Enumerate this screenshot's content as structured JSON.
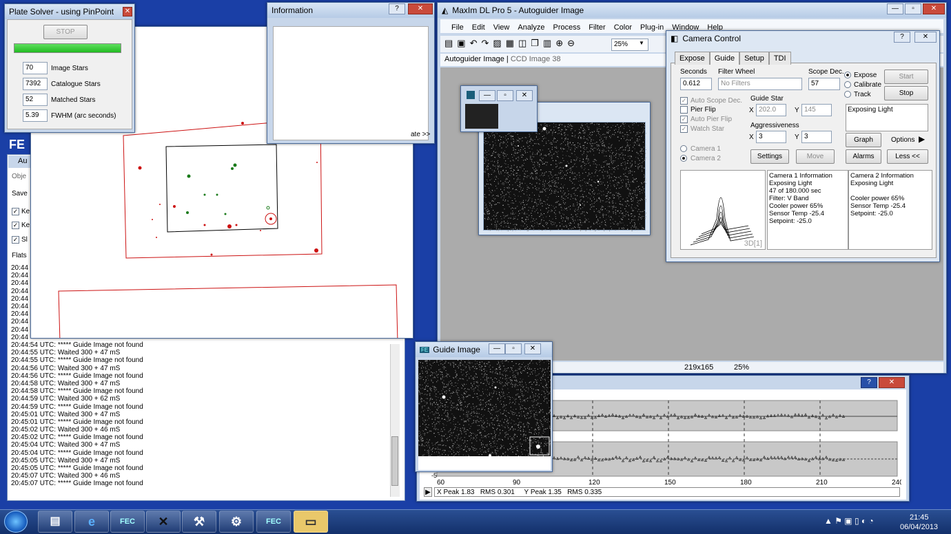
{
  "plate_solver": {
    "title": "Plate Solver - using PinPoint",
    "stop": "STOP",
    "progress": 1.0,
    "rows": [
      {
        "value": "70",
        "label": "Image Stars"
      },
      {
        "value": "7392",
        "label": "Catalogue Stars"
      },
      {
        "value": "52",
        "label": "Matched Stars"
      },
      {
        "value": "5.39",
        "label": "FWHM (arc seconds)"
      }
    ]
  },
  "information": {
    "title": "Information",
    "frag": "ate >>"
  },
  "left_panel": {
    "tab": "Obje",
    "save": "Save",
    "k1": "Ke",
    "k2": "Ke",
    "s1": "Sl",
    "flats": "Flats",
    "icon_text": "FE",
    "au": "Au",
    "log_top": [
      "20:44",
      "20:44",
      "20:44",
      "20:44",
      "20:44",
      "20:44",
      "20:44",
      "20:44",
      "20:44",
      "20:44"
    ],
    "log": [
      "20:44:54 UTC: ***** Guide Image not found",
      "20:44:55 UTC: Waited 300 + 47 mS",
      "20:44:55 UTC: ***** Guide Image not found",
      "20:44:56 UTC: Waited 300 + 47 mS",
      "20:44:56 UTC: ***** Guide Image not found",
      "20:44:58 UTC: Waited 300 + 47 mS",
      "20:44:58 UTC: ***** Guide Image not found",
      "20:44:59 UTC: Waited 300 + 62 mS",
      "20:44:59 UTC: ***** Guide Image not found",
      "20:45:01 UTC: Waited 300 + 47 mS",
      "20:45:01 UTC: ***** Guide Image not found",
      "20:45:02 UTC: Waited 300 + 46 mS",
      "20:45:02 UTC: ***** Guide Image not found",
      "20:45:04 UTC: Waited 300 + 47 mS",
      "20:45:04 UTC: ***** Guide Image not found",
      "20:45:05 UTC: Waited 300 + 47 mS",
      "20:45:05 UTC: ***** Guide Image not found",
      "20:45:07 UTC: Waited 300 + 46 mS",
      "20:45:07 UTC: ***** Guide Image not found"
    ]
  },
  "maxim": {
    "title": "MaxIm DL Pro 5 - Autoguider Image",
    "menu": [
      "File",
      "Edit",
      "View",
      "Analyze",
      "Process",
      "Filter",
      "Color",
      "Plug-in",
      "Window",
      "Help"
    ],
    "zoom": "25%",
    "tabs": [
      "Autoguider Image",
      "CCD Image 38"
    ],
    "status_size": "219x165",
    "status_zoom": "25%"
  },
  "camera": {
    "title": "Camera Control",
    "tabs": [
      "Expose",
      "Guide",
      "Setup",
      "TDI"
    ],
    "seconds_label": "Seconds",
    "seconds": "0.612",
    "filter_label": "Filter Wheel",
    "filter": "No Filters",
    "scope_label": "Scope Dec.",
    "scope": "57",
    "expose": "Expose",
    "calibrate": "Calibrate",
    "track": "Track",
    "start": "Start",
    "stop": "Stop",
    "auto_scope": "Auto Scope Dec.",
    "pier_flip": "Pier Flip",
    "auto_pier": "Auto Pier Flip",
    "watch_star": "Watch Star",
    "guide_star": "Guide Star",
    "gx_label": "X",
    "gx": "202.0",
    "gy_label": "Y",
    "gy": "145",
    "aggr": "Aggressiveness",
    "ax_label": "X",
    "ax": "3",
    "ay_label": "Y",
    "ay": "3",
    "status": "Exposing Light",
    "graph": "Graph",
    "options": "Options",
    "alarms": "Alarms",
    "less": "Less <<",
    "cam1": "Camera 1",
    "cam2": "Camera 2",
    "settings": "Settings",
    "move": "Move",
    "plot3d": "3D[1]",
    "cam1_info": [
      "Camera 1 Information",
      "Exposing Light",
      "47 of 180.000 sec",
      "Filter: V Band",
      "Cooler power 65%",
      "Sensor Temp -25.4",
      "Setpoint: -25.0"
    ],
    "cam2_info": [
      "Camera 2 Information",
      "Exposing Light",
      "",
      "Cooler power 65%",
      "Sensor Temp -25.4",
      "Setpoint: -25.0"
    ]
  },
  "guide_image": {
    "title": "Guide Image"
  },
  "graph": {
    "xticks": [
      "60",
      "90",
      "120",
      "150",
      "180",
      "210",
      "240"
    ],
    "ytick": "-5",
    "status": "X Peak 1.83   RMS 0.301     Y Peak 1.35   RMS 0.335"
  },
  "taskbar": {
    "time": "21:45",
    "date": "06/04/2013",
    "fec": "FEC"
  },
  "colors": {
    "desktop": "#1a3fa6",
    "red": "#cc1111",
    "green": "#1a7a1a",
    "progress": "#22bb22"
  }
}
